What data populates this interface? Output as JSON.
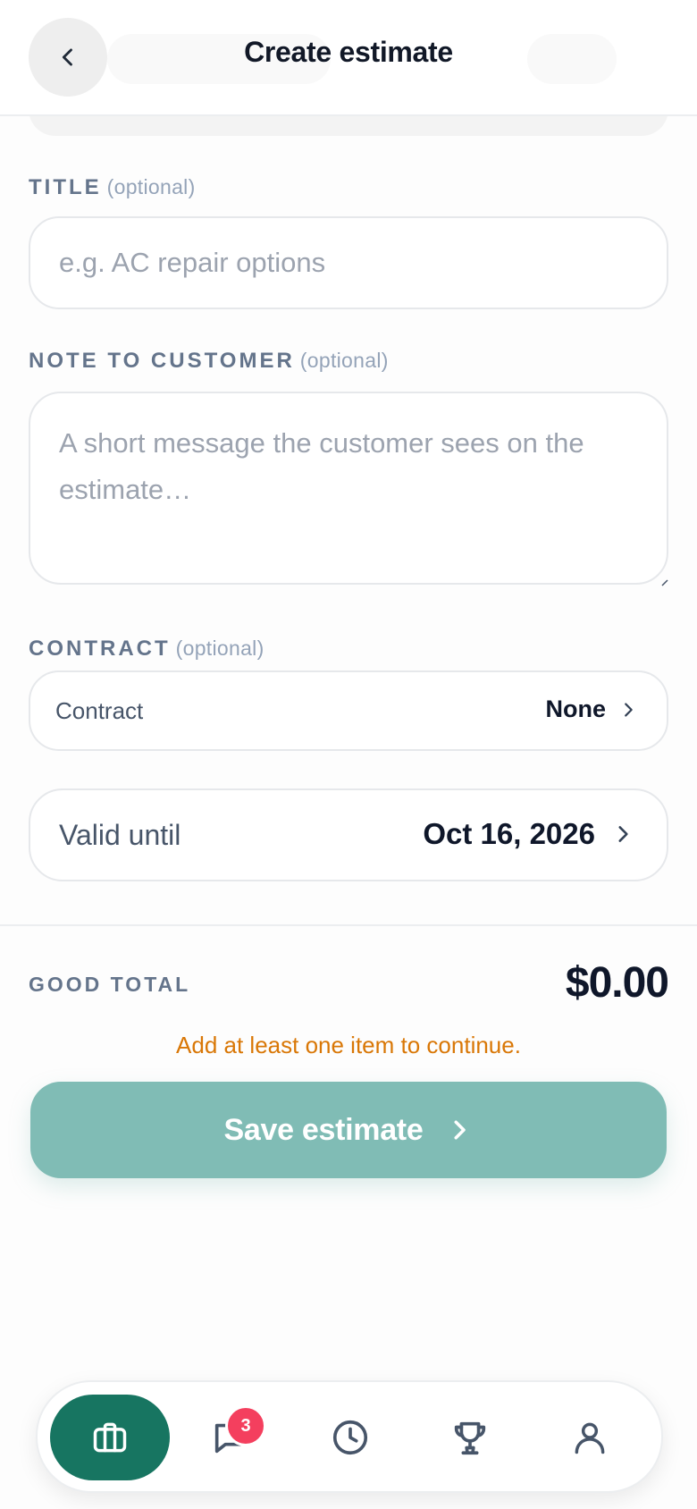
{
  "header": {
    "title": "Create estimate"
  },
  "form": {
    "title_field": {
      "label": "TITLE",
      "optional": "(optional)",
      "placeholder": "e.g. AC repair options",
      "value": ""
    },
    "note_field": {
      "label": "NOTE TO CUSTOMER",
      "optional": "(optional)",
      "placeholder": "A short message the customer sees on the estimate…",
      "value": ""
    },
    "contract": {
      "label": "CONTRACT",
      "optional": "(optional)",
      "row_label": "Contract",
      "value": "None"
    },
    "valid_until": {
      "label": "Valid until",
      "value": "Oct 16, 2026"
    }
  },
  "summary": {
    "total_label": "GOOD TOTAL",
    "total_value": "$0.00",
    "warning": "Add at least one item to continue.",
    "save_label": "Save estimate"
  },
  "nav": {
    "items": [
      {
        "name": "jobs",
        "icon": "briefcase-icon",
        "active": true
      },
      {
        "name": "messages",
        "icon": "chat-icon",
        "badge": "3"
      },
      {
        "name": "history",
        "icon": "clock-icon"
      },
      {
        "name": "achievements",
        "icon": "trophy-icon"
      },
      {
        "name": "profile",
        "icon": "user-icon"
      }
    ]
  },
  "colors": {
    "primary": "#177561",
    "save_button_disabled": "#80bcb5",
    "warning": "#d97706",
    "badge": "#f43f5e"
  }
}
